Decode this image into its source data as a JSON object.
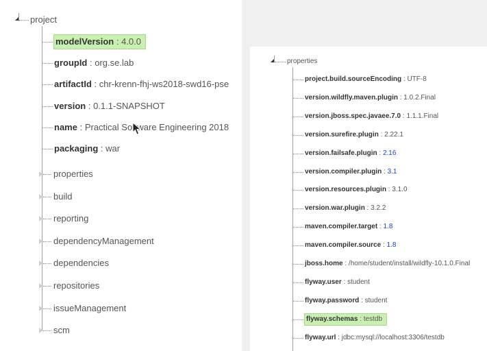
{
  "left": {
    "root": "project",
    "leaves": [
      {
        "key": "modelVersion",
        "value": "4.0.0",
        "highlight": true
      },
      {
        "key": "groupId",
        "value": "org.se.lab"
      },
      {
        "key": "artifactId",
        "value": "chr-krenn-fhj-ws2018-swd16-pse"
      },
      {
        "key": "version",
        "value": "0.1.1-SNAPSHOT"
      },
      {
        "key": "name",
        "value": "Practical Software Engineering 2018"
      },
      {
        "key": "packaging",
        "value": "war"
      }
    ],
    "collapsed": [
      "properties",
      "build",
      "reporting",
      "dependencyManagement",
      "dependencies",
      "repositories",
      "issueManagement",
      "scm"
    ]
  },
  "right": {
    "root": "properties",
    "leaves": [
      {
        "key": "project.build.sourceEncoding",
        "value": "UTF-8"
      },
      {
        "key": "version.wildfly.maven.plugin",
        "value": "1.0.2.Final"
      },
      {
        "key": "version.jboss.spec.javaee.7.0",
        "value": "1.1.1.Final"
      },
      {
        "key": "version.surefire.plugin",
        "value": "2.22.1"
      },
      {
        "key": "version.failsafe.plugin",
        "value": "2.16",
        "blue": true
      },
      {
        "key": "version.compiler.plugin",
        "value": "3.1",
        "blue": true
      },
      {
        "key": "version.resources.plugin",
        "value": "3.1.0"
      },
      {
        "key": "version.war.plugin",
        "value": "3.2.2"
      },
      {
        "key": "maven.compiler.target",
        "value": "1.8",
        "blue": true
      },
      {
        "key": "maven.compiler.source",
        "value": "1.8",
        "blue": true
      },
      {
        "key": "jboss.home",
        "value": "/home/student/install/wildfly-10.1.0.Final"
      },
      {
        "key": "flyway.user",
        "value": "student"
      },
      {
        "key": "flyway.password",
        "value": "student"
      },
      {
        "key": "flyway.schemas",
        "value": "testdb",
        "highlight": true
      },
      {
        "key": "flyway.url",
        "value": "jdbc:mysql://localhost:3306/testdb"
      }
    ]
  },
  "colors": {
    "highlight": "#c9f0b0",
    "value_blue": "#1a3fd6",
    "background": "#f0f0f0"
  }
}
